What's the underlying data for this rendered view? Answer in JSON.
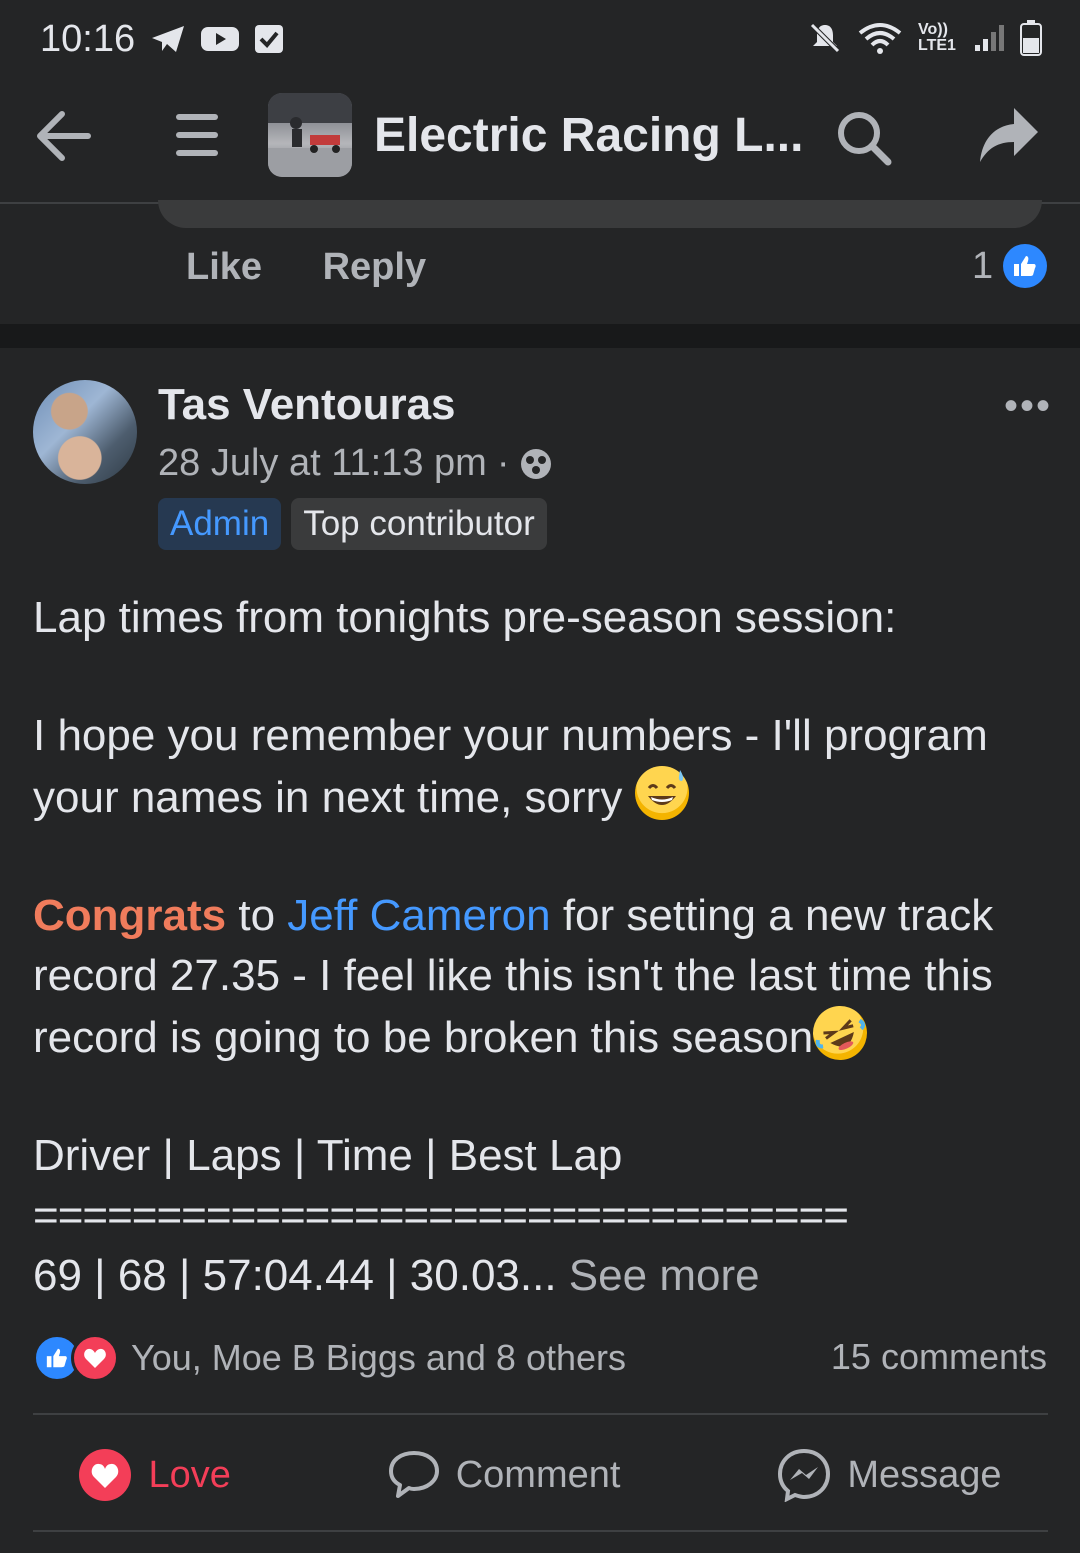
{
  "status_bar": {
    "time": "10:16",
    "network": "Vo)) LTE1"
  },
  "header": {
    "title": "Electric Racing L..."
  },
  "previous_comment": {
    "like_label": "Like",
    "reply_label": "Reply",
    "like_count": "1"
  },
  "post": {
    "author": "Tas Ventouras",
    "timestamp": "28 July at 11:13 pm",
    "meta_separator": "·",
    "badges": [
      "Admin",
      "Top contributor"
    ],
    "body": {
      "line1": "Lap times from tonights pre-season session:",
      "line2": "I hope you remember your numbers - I'll program your names in next time, sorry",
      "congrats": "Congrats",
      "to": " to ",
      "mention": "Jeff Cameron",
      "line3_rest": " for setting a new track record 27.35 - I feel like this isn't the last time this record is going to be broken this season",
      "table_header": "Driver | Laps | Time | Best Lap",
      "divider": "=================================",
      "first_row": "69 | 68 | 57:04.44 | 30.03...",
      "see_more": " See more"
    },
    "reactions_text": "You, Moe B Biggs and 8 others",
    "comments_count": "15 comments"
  },
  "actions": {
    "love": "Love",
    "comment": "Comment",
    "message": "Message"
  },
  "colors": {
    "accent": "#2d88ff",
    "love": "#f33e58",
    "congrats": "#f07c5c",
    "background": "#242526"
  }
}
